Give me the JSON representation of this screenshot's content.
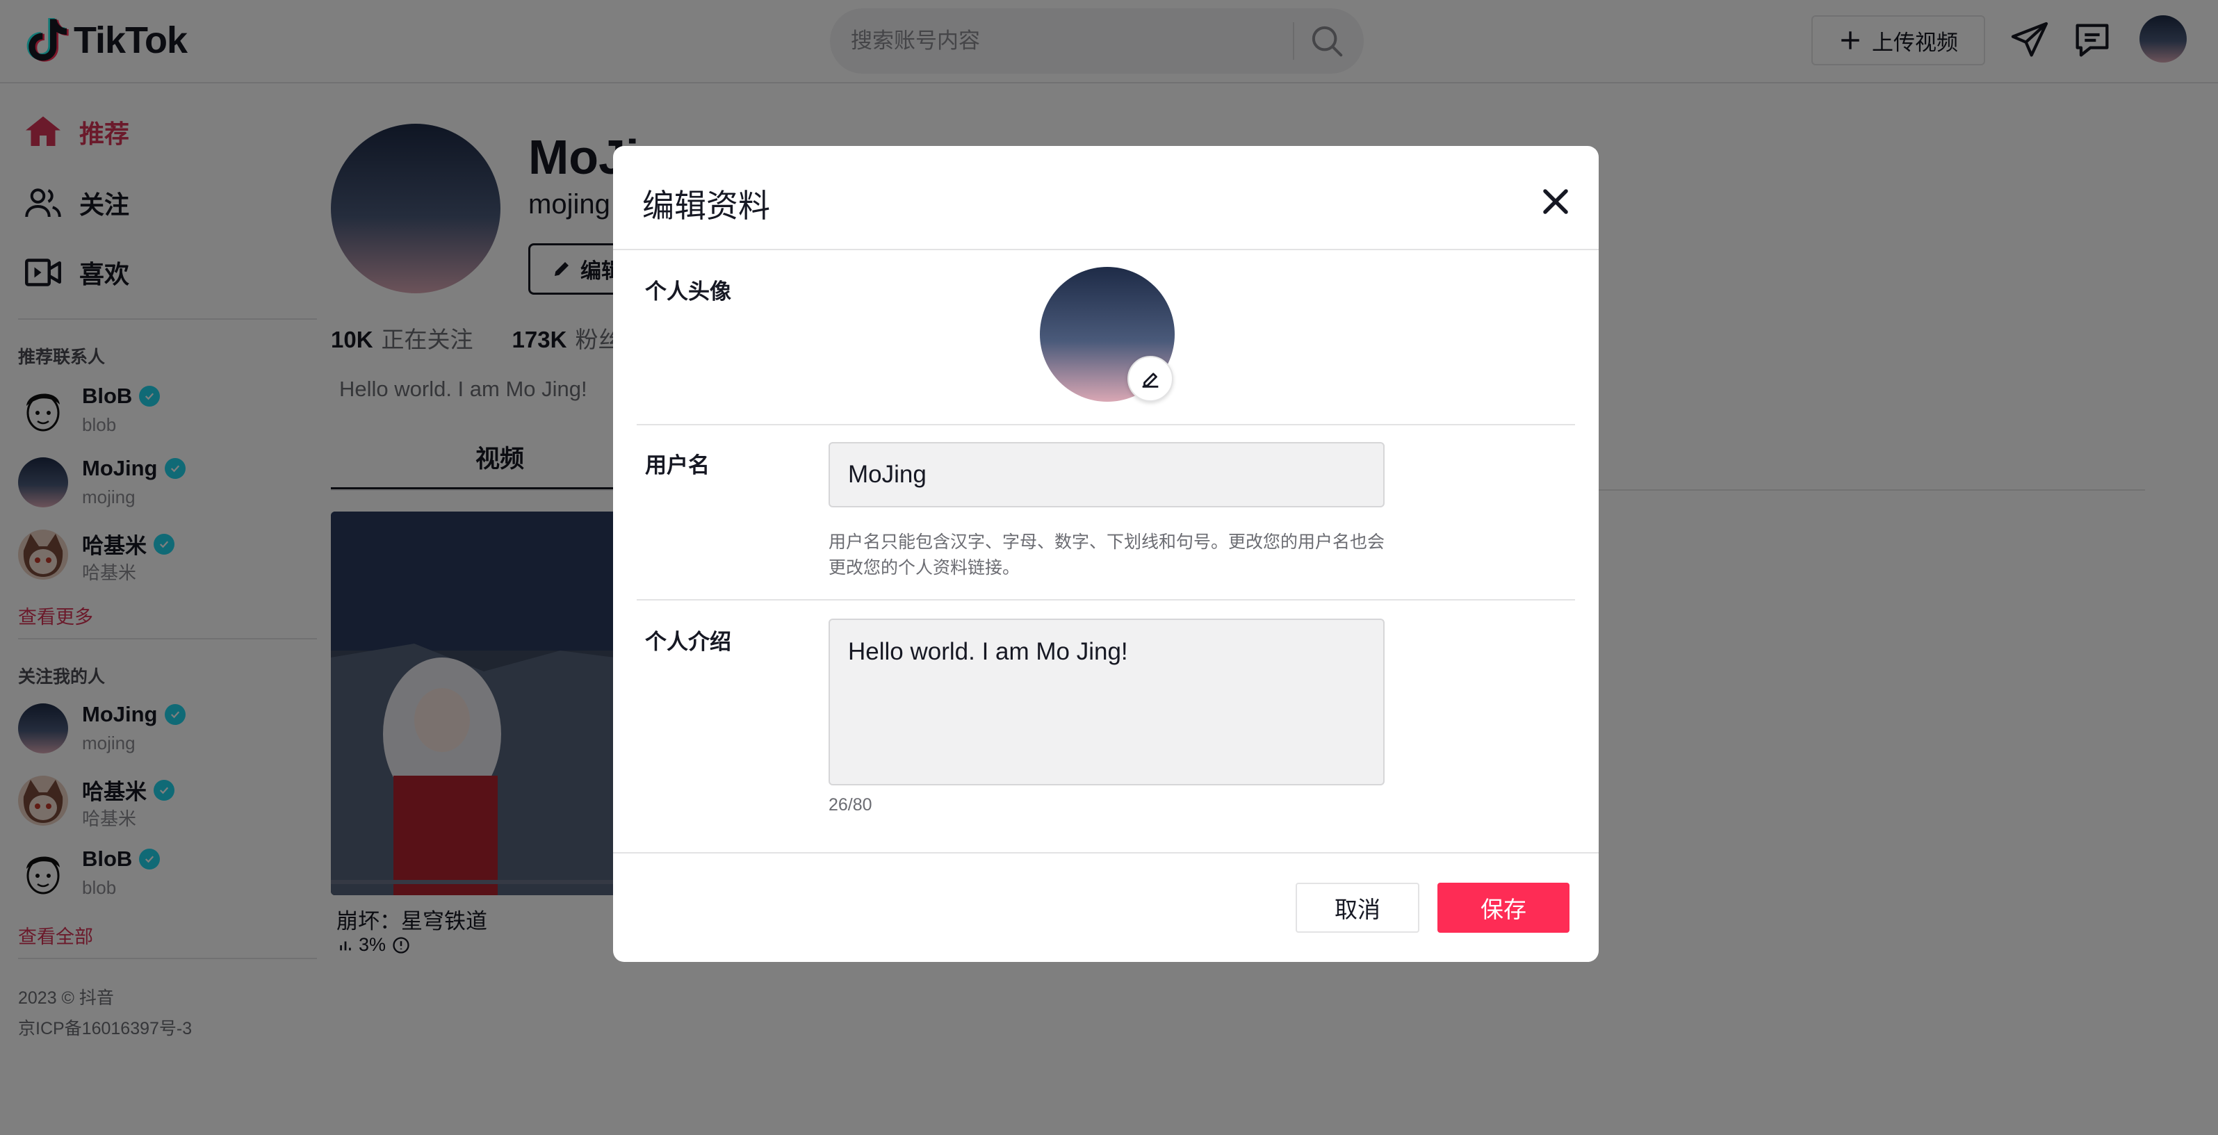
{
  "header": {
    "logo_text": "TikTok",
    "search_placeholder": "搜索账号内容",
    "upload_label": "上传视频"
  },
  "sidebar": {
    "nav": [
      {
        "label": "推荐",
        "icon": "home-icon",
        "active": true
      },
      {
        "label": "关注",
        "icon": "users-icon",
        "active": false
      },
      {
        "label": "喜欢",
        "icon": "video-icon",
        "active": false
      }
    ],
    "suggested_title": "推荐联系人",
    "suggested": [
      {
        "name": "BloB",
        "username": "blob"
      },
      {
        "name": "MoJing",
        "username": "mojing"
      },
      {
        "name": "哈基米",
        "username": "哈基米"
      }
    ],
    "see_more": "查看更多",
    "followers_title": "关注我的人",
    "followers": [
      {
        "name": "MoJing",
        "username": "mojing"
      },
      {
        "name": "哈基米",
        "username": "哈基米"
      },
      {
        "name": "BloB",
        "username": "blob"
      }
    ],
    "see_all": "查看全部",
    "copyright": "2023 © 抖音",
    "icp": "京ICP备16016397号-3"
  },
  "profile": {
    "name": "MoJi",
    "handle": "mojing",
    "edit_label": "编辑",
    "following_count": "10K",
    "following_label": "正在关注",
    "followers_count": "173K",
    "followers_label": "粉丝",
    "bio": "Hello world. I am Mo Jing!",
    "tab_videos": "视频",
    "video": {
      "title": "崩坏：星穹铁道",
      "views": "3%"
    }
  },
  "modal": {
    "title": "编辑资料",
    "avatar_label": "个人头像",
    "username_label": "用户名",
    "username_value": "MoJing",
    "username_hint": "用户名只能包含汉字、字母、数字、下划线和句号。更改您的用户名也会更改您的个人资料链接。",
    "bio_label": "个人介绍",
    "bio_value": "Hello world. I am Mo Jing!",
    "bio_counter": "26/80",
    "cancel_label": "取消",
    "save_label": "保存"
  },
  "colors": {
    "accent": "#fe2c55",
    "active_nav": "#d73456",
    "verified": "#20d5ec"
  }
}
